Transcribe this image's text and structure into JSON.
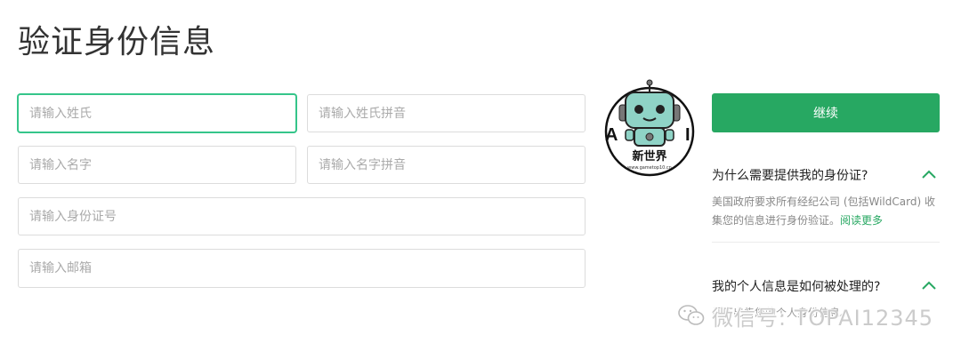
{
  "page": {
    "title": "验证身份信息"
  },
  "form": {
    "surname_placeholder": "请输入姓氏",
    "surname_pinyin_placeholder": "请输入姓氏拼音",
    "given_name_placeholder": "请输入名字",
    "given_name_pinyin_placeholder": "请输入名字拼音",
    "id_number_placeholder": "请输入身份证号",
    "email_placeholder": "请输入邮箱"
  },
  "logo": {
    "left_letter": "A",
    "right_letter": "I",
    "caption": "新世界",
    "url": "www.gametop10.cn"
  },
  "sidebar": {
    "continue_label": "继续",
    "faq": [
      {
        "question": "为什么需要提供我的身份证?",
        "answer": "美国政府要求所有经纪公司 (包括WildCard) 收集您的信息进行身份验证。",
        "link": "阅读更多"
      },
      {
        "question": "我的个人信息是如何被处理的?",
        "answer": "们不出售您的个人身份信息。"
      }
    ]
  },
  "watermark": {
    "text": "微信号: TOPAI12345"
  },
  "colors": {
    "accent": "#27a862",
    "focus_border": "#35c58a"
  }
}
